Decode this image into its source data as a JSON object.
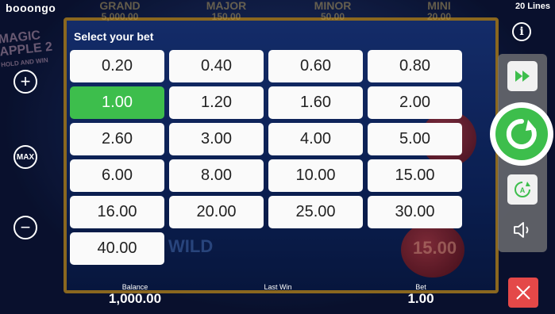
{
  "header": {
    "brand": "booongo",
    "lines": "20 Lines"
  },
  "background": {
    "jackpots": [
      {
        "name": "GRAND",
        "value": "5,000.00"
      },
      {
        "name": "MAJOR",
        "value": "150.00"
      },
      {
        "name": "MINOR",
        "value": "50.00"
      },
      {
        "name": "MINI",
        "value": "20.00"
      }
    ],
    "logo_line1": "MAGIC",
    "logo_line2": "APPLE 2",
    "logo_line3": "HOLD AND WIN",
    "wild_symbol": "WILD",
    "coin_symbol": "15.00"
  },
  "controls": {
    "plus": "+",
    "max": "MAX",
    "minus": "−",
    "info": "i"
  },
  "bet_panel": {
    "title": "Select your bet",
    "selected_index": 4,
    "options": [
      "0.20",
      "0.40",
      "0.60",
      "0.80",
      "1.00",
      "1.20",
      "1.60",
      "2.00",
      "2.60",
      "3.00",
      "4.00",
      "5.00",
      "6.00",
      "8.00",
      "10.00",
      "15.00",
      "16.00",
      "20.00",
      "25.00",
      "30.00",
      "40.00"
    ]
  },
  "footer": {
    "balance_label": "Balance",
    "balance_value": "1,000.00",
    "last_win_label": "Last Win",
    "last_win_value": "",
    "bet_label": "Bet",
    "bet_value": "1.00"
  },
  "colors": {
    "accent_green": "#3dbe4c",
    "close_red": "#e44848"
  },
  "icons": {
    "turbo": "fast-forward-icon",
    "spin": "spin-arrow-icon",
    "autoplay": "autoplay-icon",
    "sound": "speaker-icon",
    "close": "close-icon"
  }
}
